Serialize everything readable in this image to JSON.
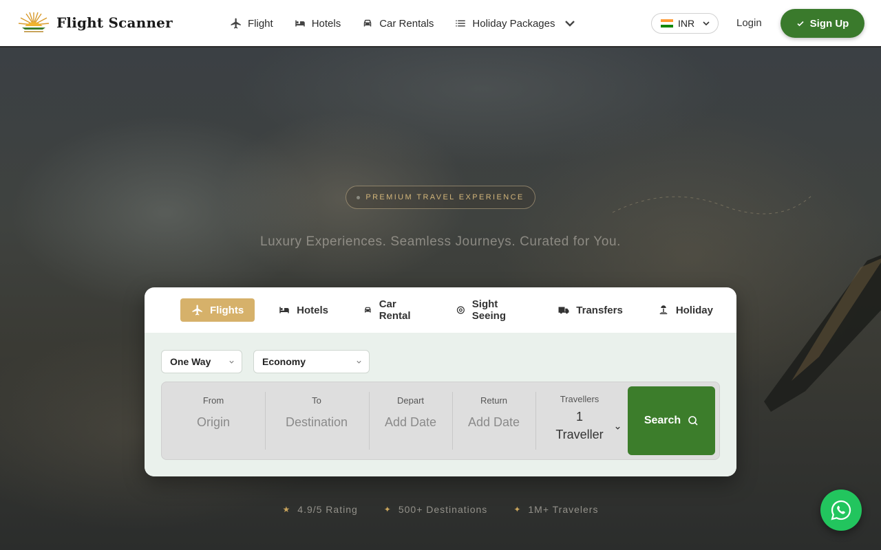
{
  "header": {
    "brand": "Flight Scanner",
    "nav": [
      {
        "label": "Flight",
        "icon": "plane-icon"
      },
      {
        "label": "Hotels",
        "icon": "bed-icon"
      },
      {
        "label": "Car Rentals",
        "icon": "car-icon"
      },
      {
        "label": "Holiday Packages",
        "icon": "list-icon"
      }
    ],
    "currency": "INR",
    "login": "Login",
    "signup": "Sign Up"
  },
  "hero": {
    "badge": "PREMIUM TRAVEL EXPERIENCE",
    "tagline": "Luxury Experiences. Seamless Journeys. Curated for You."
  },
  "search": {
    "tabs": [
      {
        "label": "Flights",
        "icon": "plane-icon",
        "active": true
      },
      {
        "label": "Hotels",
        "icon": "bed-icon"
      },
      {
        "label": "Car Rental",
        "icon": "car-icon"
      },
      {
        "label": "Sight Seeing",
        "icon": "compass-icon"
      },
      {
        "label": "Transfers",
        "icon": "truck-icon"
      },
      {
        "label": "Holiday",
        "icon": "beach-icon"
      }
    ],
    "trip_type": "One Way",
    "cabin_class": "Economy",
    "from": {
      "label": "From",
      "placeholder": "Origin"
    },
    "to": {
      "label": "To",
      "placeholder": "Destination"
    },
    "depart": {
      "label": "Depart",
      "placeholder": "Add Date"
    },
    "return": {
      "label": "Return",
      "placeholder": "Add Date"
    },
    "travellers": {
      "label": "Travellers",
      "count": "1",
      "unit": "Traveller"
    },
    "search_label": "Search"
  },
  "stats": [
    {
      "icon": "★",
      "text": "4.9/5 Rating"
    },
    {
      "icon": "✦",
      "text": "500+ Destinations"
    },
    {
      "icon": "✦",
      "text": "1M+ Travelers"
    }
  ],
  "colors": {
    "brand_green": "#3a7a2c",
    "gold": "#d6b16a",
    "whatsapp": "#22c55e"
  }
}
